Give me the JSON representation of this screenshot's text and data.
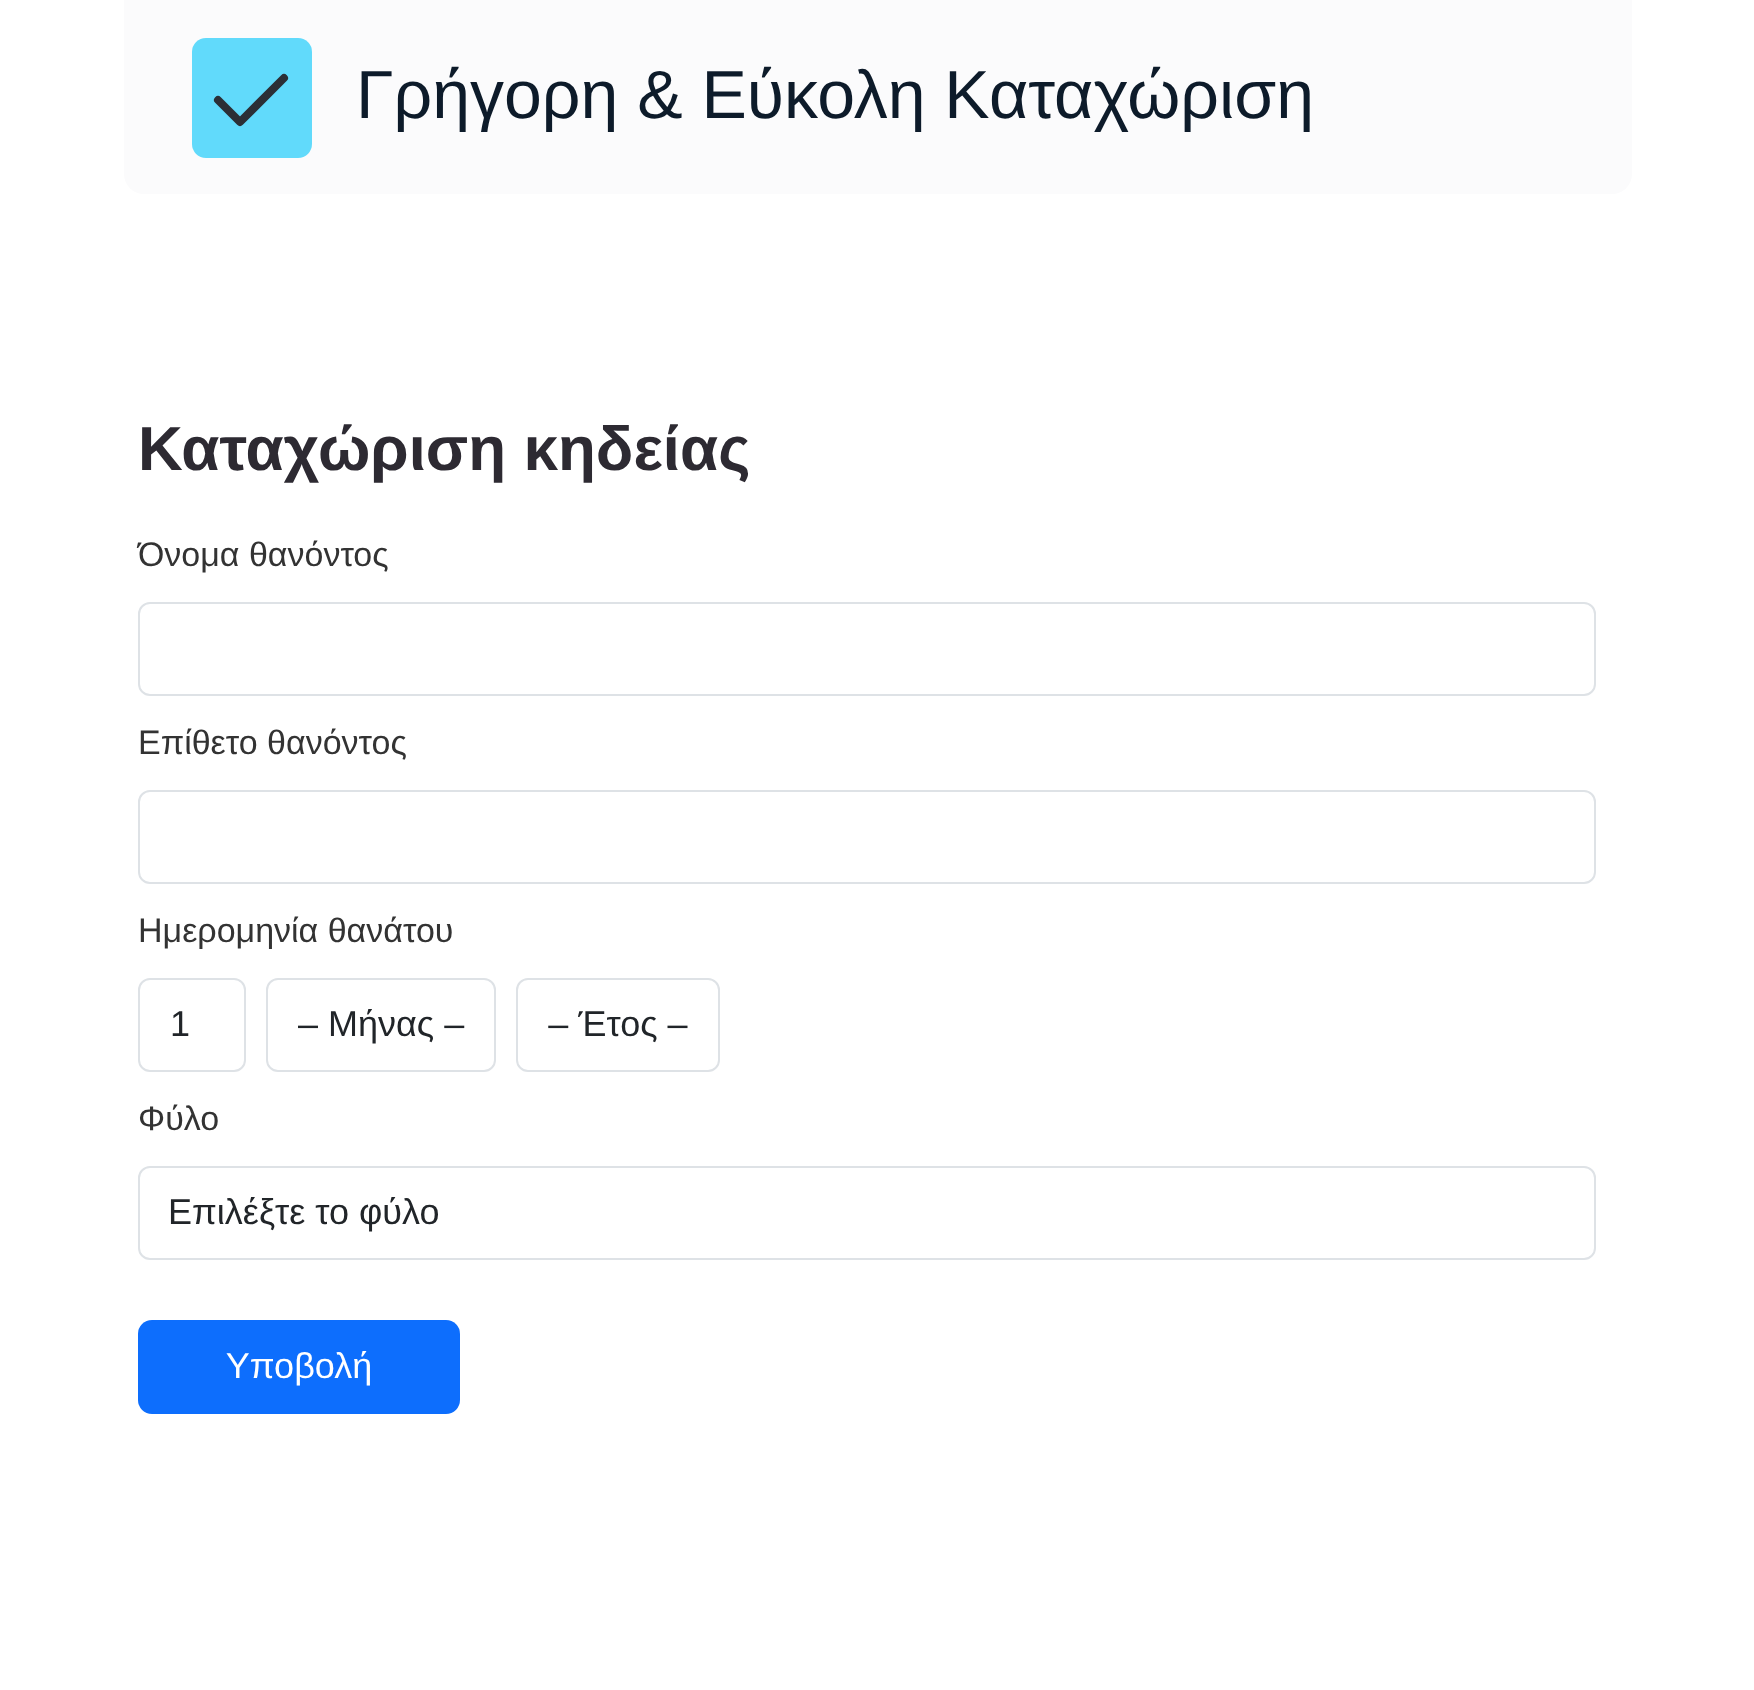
{
  "header": {
    "title": "Γρήγορη & Εύκολη Καταχώριση"
  },
  "form": {
    "heading": "Καταχώριση κηδείας",
    "fields": [
      {
        "kind": "text",
        "label": "Όνομα θανόντος"
      },
      {
        "kind": "text",
        "label": "Επίθετο θανόντος"
      },
      {
        "kind": "date",
        "label": "Ημερομηνία θανάτου",
        "day": "1",
        "month": "– Μήνας –",
        "year": "– Έτος –"
      },
      {
        "kind": "select",
        "label": "Φύλο",
        "value": "Επιλέξτε το φύλο"
      }
    ],
    "submit": "Υποβολή"
  }
}
